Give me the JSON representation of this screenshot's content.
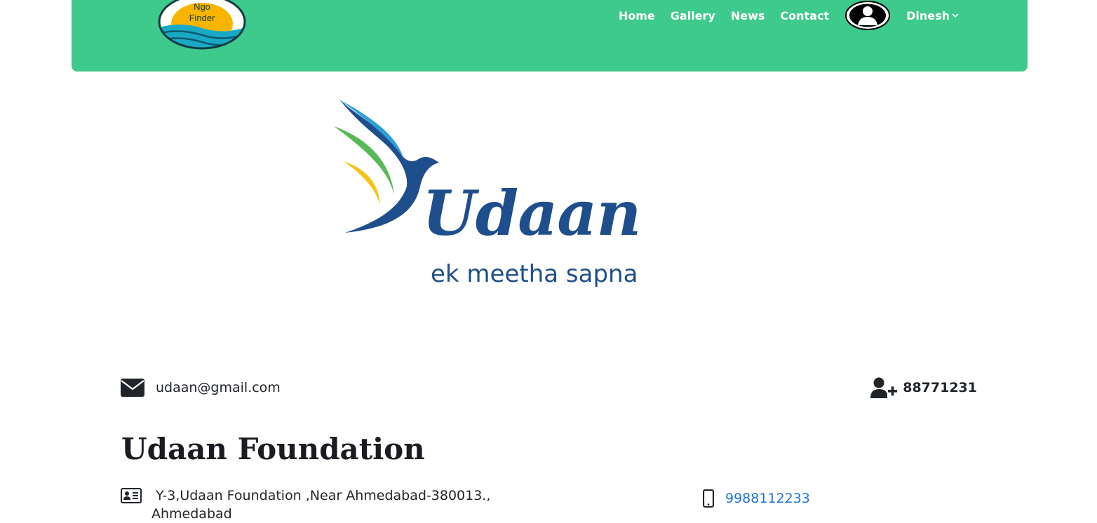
{
  "site": {
    "logo_text_line1": "Ngo",
    "logo_text_line2": "Finder"
  },
  "nav": {
    "items": [
      {
        "label": "Home"
      },
      {
        "label": "Gallery"
      },
      {
        "label": "News"
      },
      {
        "label": "Contact"
      }
    ],
    "user_name": "Dinesh"
  },
  "hero": {
    "logo_word": "Udaan",
    "logo_tagline": "ek meetha sapna"
  },
  "contact": {
    "email": "udaan@gmail.com",
    "registration": "88771231",
    "phone": "9988112233"
  },
  "org": {
    "name": "Udaan Foundation",
    "address": "Y-3,Udaan Foundation ,Near Ahmedabad-380013., Ahmedabad"
  },
  "colors": {
    "header": "#3ec98d",
    "brand_blue": "#1f4e8c",
    "link": "#1e73d6"
  }
}
